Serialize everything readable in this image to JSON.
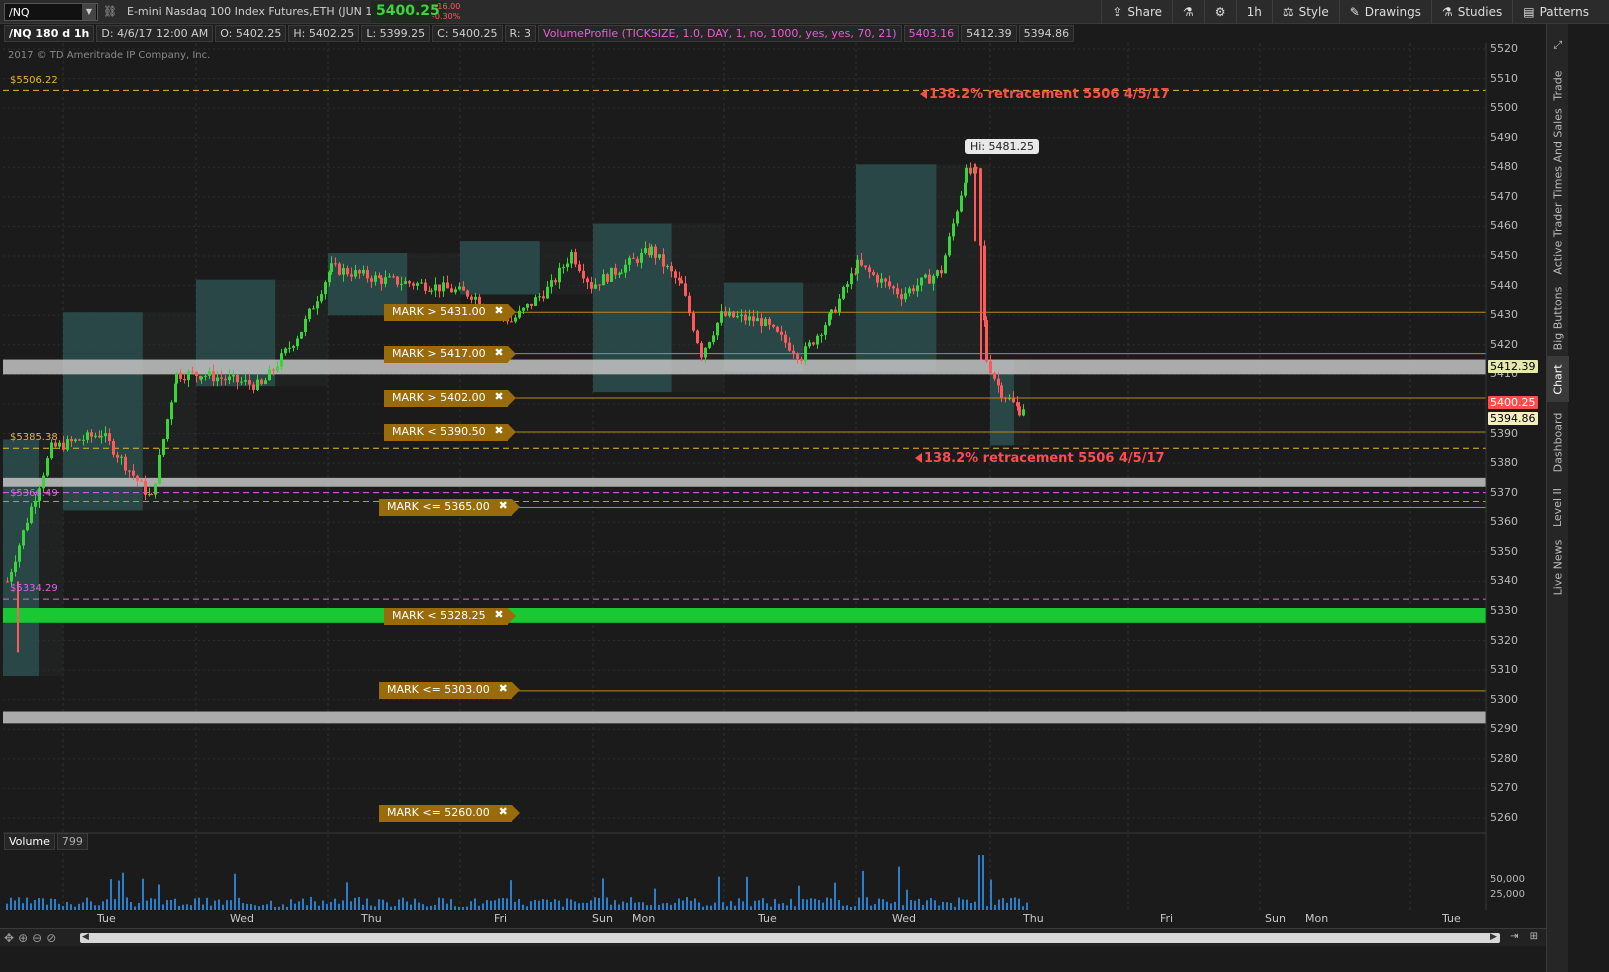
{
  "header": {
    "symbol": "/NQ",
    "instrument": "E-mini Nasdaq 100 Index Futures,ETH (JUN 17)",
    "last_price": "5400.25",
    "change": "-16.00",
    "change_pct": "-0.30%"
  },
  "toolbar": {
    "share": "Share",
    "timeframe": "1h",
    "style": "Style",
    "drawings": "Drawings",
    "studies": "Studies",
    "patterns": "Patterns"
  },
  "info": {
    "chart_id": "/NQ 180 d 1h",
    "date": "D: 4/6/17 12:00 AM",
    "open": "O: 5402.25",
    "high": "H: 5402.25",
    "low": "L: 5399.25",
    "close": "C: 5400.25",
    "range": "R: 3",
    "study": "VolumeProfile (TICKSIZE, 1.0, DAY, 1, no, 1000, yes, yes, 70, 21)",
    "v1": "5403.16",
    "v2": "5412.39",
    "v3": "5394.86"
  },
  "copyright": "2017 © TD Ameritrade IP Company, Inc.",
  "levels": {
    "l1": "$5506.22",
    "l2": "$5385.38",
    "l3": "$5366.49",
    "l4": "$5334.29"
  },
  "retracement_text": "138.2% retracement 5506 4/5/17",
  "hi_label": "Hi: 5481.25",
  "marks": [
    {
      "label": "MARK > 5431.00"
    },
    {
      "label": "MARK > 5417.00"
    },
    {
      "label": "MARK > 5402.00"
    },
    {
      "label": "MARK < 5390.50"
    },
    {
      "label": "MARK <= 5365.00"
    },
    {
      "label": "MARK < 5328.25"
    },
    {
      "label": "MARK <= 5303.00"
    },
    {
      "label": "MARK <= 5260.00"
    }
  ],
  "price_ticks": [
    "5520",
    "5510",
    "5500",
    "5490",
    "5480",
    "5470",
    "5460",
    "5450",
    "5440",
    "5430",
    "5420",
    "5410",
    "5400",
    "5390",
    "5380",
    "5370",
    "5360",
    "5350",
    "5340",
    "5330",
    "5320",
    "5310",
    "5300",
    "5290",
    "5280",
    "5270",
    "5260"
  ],
  "price_tags": {
    "t1": "5412.39",
    "t2": "5400.25",
    "t3": "5394.86"
  },
  "side_tabs": [
    "Trade",
    "Times And Sales",
    "Active Trader",
    "Big Buttons",
    "Chart",
    "Dashboard",
    "Level II",
    "Live News"
  ],
  "volume": {
    "label": "Volume",
    "count": "799",
    "ticks": [
      "50,000",
      "25,000"
    ]
  },
  "days": [
    "Tue",
    "Wed",
    "Thu",
    "Fri",
    "Sun",
    "Mon",
    "Tue",
    "Wed",
    "Thu",
    "Fri",
    "Sun",
    "Mon",
    "Tue"
  ],
  "colors": {
    "up": "#3bd43b",
    "down": "#ff5a5a",
    "profile": "#2e6e6b",
    "mark": "#9a6b0a",
    "green_zone": "#19c934",
    "gray_zone": "#c4c4c4"
  }
}
